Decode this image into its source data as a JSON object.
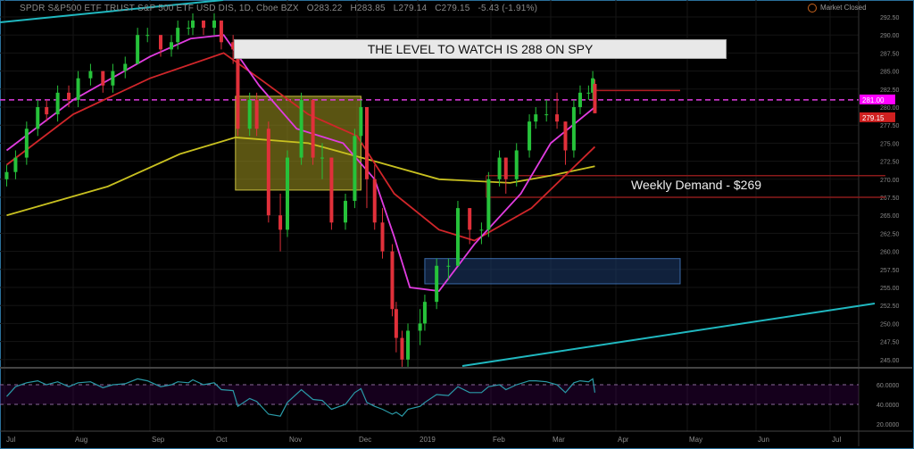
{
  "header": {
    "symbol": "SPDR S&P500 ETF TRUST S&P 500 ETF USD DIS, 1D, Cboe BZX",
    "open": "O283.22",
    "high": "H283.85",
    "low": "L279.14",
    "close": "C279.15",
    "change": "-5.43 (-1.91%)",
    "market_status": "Market Closed"
  },
  "annotations": {
    "title": "THE LEVEL TO WATCH IS 288 ON SPY",
    "weekly_demand": "Weekly Demand - $269"
  },
  "price_labels": {
    "level": "281.00",
    "last": "279.15"
  },
  "colors": {
    "up": "#26c23a",
    "down": "#e0303a",
    "ma_fast": "#e03ce0",
    "ma_mid": "#d0262a",
    "ma_slow": "#c8c020",
    "trend": "#20b8c0",
    "rsi": "#2a9aa8"
  },
  "chart_data": {
    "type": "candlestick",
    "title": "SPDR S&P500 ETF TRUST, 1D",
    "ylim": [
      244,
      294
    ],
    "yticks": [
      "292.50",
      "290.00",
      "287.50",
      "285.00",
      "282.50",
      "280.00",
      "277.50",
      "275.00",
      "272.50",
      "270.00",
      "267.50",
      "265.00",
      "262.50",
      "260.00",
      "257.50",
      "255.00",
      "252.50",
      "250.00",
      "247.50",
      "245.00"
    ],
    "xticks": [
      "Jul",
      "Aug",
      "Sep",
      "Oct",
      "Nov",
      "Dec",
      "2019",
      "Feb",
      "Mar",
      "Apr",
      "May",
      "Jun",
      "Jul"
    ],
    "candles": [
      [
        "2018-07-02",
        270,
        272,
        269,
        271
      ],
      [
        "2018-07-06",
        271,
        274,
        270,
        273
      ],
      [
        "2018-07-11",
        273,
        278,
        272,
        277
      ],
      [
        "2018-07-16",
        277,
        281,
        276,
        280
      ],
      [
        "2018-07-20",
        280,
        281,
        278,
        279
      ],
      [
        "2018-07-25",
        279,
        283,
        278,
        282
      ],
      [
        "2018-07-30",
        282,
        283,
        280,
        281
      ],
      [
        "2018-08-03",
        281,
        285,
        280,
        284
      ],
      [
        "2018-08-08",
        284,
        286,
        283,
        285
      ],
      [
        "2018-08-13",
        285,
        285,
        282,
        283
      ],
      [
        "2018-08-17",
        283,
        286,
        282,
        285
      ],
      [
        "2018-08-22",
        285,
        287,
        284,
        286
      ],
      [
        "2018-08-27",
        286,
        291,
        286,
        290
      ],
      [
        "2018-08-31",
        290,
        291,
        289,
        290
      ],
      [
        "2018-09-06",
        290,
        290,
        287,
        288
      ],
      [
        "2018-09-11",
        288,
        290,
        287,
        289
      ],
      [
        "2018-09-14",
        289,
        292,
        288,
        291
      ],
      [
        "2018-09-19",
        291,
        292,
        290,
        291
      ],
      [
        "2018-09-21",
        291,
        293,
        290,
        292
      ],
      [
        "2018-09-26",
        292,
        292,
        290,
        291
      ],
      [
        "2018-10-01",
        291,
        293,
        290,
        292
      ],
      [
        "2018-10-04",
        292,
        292,
        288,
        289
      ],
      [
        "2018-10-09",
        289,
        290,
        286,
        288
      ],
      [
        "2018-10-11",
        288,
        288,
        276,
        277
      ],
      [
        "2018-10-16",
        277,
        282,
        276,
        281
      ],
      [
        "2018-10-19",
        281,
        282,
        276,
        277
      ],
      [
        "2018-10-24",
        277,
        278,
        264,
        265
      ],
      [
        "2018-10-29",
        265,
        268,
        260,
        263
      ],
      [
        "2018-11-01",
        263,
        274,
        262,
        273
      ],
      [
        "2018-11-07",
        273,
        282,
        272,
        281
      ],
      [
        "2018-11-12",
        281,
        281,
        272,
        273
      ],
      [
        "2018-11-16",
        273,
        275,
        270,
        273
      ],
      [
        "2018-11-20",
        273,
        273,
        263,
        264
      ],
      [
        "2018-11-26",
        264,
        268,
        263,
        267
      ],
      [
        "2018-11-30",
        267,
        277,
        266,
        276
      ],
      [
        "2018-12-03",
        276,
        281,
        275,
        280
      ],
      [
        "2018-12-06",
        280,
        280,
        266,
        270
      ],
      [
        "2018-12-10",
        270,
        272,
        263,
        264
      ],
      [
        "2018-12-14",
        264,
        266,
        259,
        260
      ],
      [
        "2018-12-19",
        260,
        261,
        251,
        252
      ],
      [
        "2018-12-21",
        252,
        253,
        246,
        248
      ],
      [
        "2018-12-24",
        248,
        249,
        244,
        245
      ],
      [
        "2018-12-27",
        245,
        250,
        244,
        249
      ],
      [
        "2019-01-02",
        249,
        252,
        247,
        250
      ],
      [
        "2019-01-04",
        250,
        254,
        249,
        253
      ],
      [
        "2019-01-09",
        253,
        259,
        252,
        258
      ],
      [
        "2019-01-14",
        258,
        259,
        256,
        258
      ],
      [
        "2019-01-18",
        258,
        267,
        258,
        266
      ],
      [
        "2019-01-23",
        266,
        266,
        261,
        263
      ],
      [
        "2019-01-28",
        263,
        264,
        261,
        263
      ],
      [
        "2019-01-31",
        263,
        271,
        262,
        270
      ],
      [
        "2019-02-05",
        270,
        274,
        269,
        273
      ],
      [
        "2019-02-08",
        273,
        273,
        268,
        270
      ],
      [
        "2019-02-13",
        270,
        275,
        269,
        274
      ],
      [
        "2019-02-19",
        274,
        279,
        273,
        278
      ],
      [
        "2019-02-22",
        278,
        280,
        277,
        279
      ],
      [
        "2019-02-27",
        279,
        281,
        278,
        279
      ],
      [
        "2019-03-04",
        279,
        282,
        277,
        278
      ],
      [
        "2019-03-08",
        278,
        278,
        272,
        274
      ],
      [
        "2019-03-12",
        274,
        281,
        273,
        280
      ],
      [
        "2019-03-15",
        280,
        283,
        279,
        282
      ],
      [
        "2019-03-19",
        282,
        283,
        281,
        282
      ],
      [
        "2019-03-21",
        282,
        285,
        281,
        284
      ],
      [
        "2019-03-22",
        283.22,
        283.85,
        279.14,
        279.15
      ]
    ],
    "ma_fast": [
      [
        "2018-07-02",
        274
      ],
      [
        "2018-08-01",
        281
      ],
      [
        "2018-09-01",
        287
      ],
      [
        "2018-09-20",
        289.5
      ],
      [
        "2018-10-05",
        290
      ],
      [
        "2018-10-20",
        283
      ],
      [
        "2018-11-05",
        277
      ],
      [
        "2018-11-25",
        275
      ],
      [
        "2018-12-10",
        270
      ],
      [
        "2018-12-20",
        262
      ],
      [
        "2018-12-28",
        255
      ],
      [
        "2019-01-10",
        254.5
      ],
      [
        "2019-01-25",
        261
      ],
      [
        "2019-02-15",
        268
      ],
      [
        "2019-03-01",
        275
      ],
      [
        "2019-03-22",
        280
      ]
    ],
    "ma_mid": [
      [
        "2018-07-02",
        272
      ],
      [
        "2018-08-01",
        279
      ],
      [
        "2018-09-01",
        284
      ],
      [
        "2018-10-05",
        287.5
      ],
      [
        "2018-10-20",
        284
      ],
      [
        "2018-11-10",
        279
      ],
      [
        "2018-12-01",
        276
      ],
      [
        "2018-12-20",
        268
      ],
      [
        "2019-01-10",
        263
      ],
      [
        "2019-01-25",
        261.5
      ],
      [
        "2019-02-20",
        266
      ],
      [
        "2019-03-22",
        274.5
      ]
    ],
    "ma_slow": [
      [
        "2018-07-02",
        265
      ],
      [
        "2018-08-15",
        269
      ],
      [
        "2018-09-15",
        273.5
      ],
      [
        "2018-10-10",
        275.8
      ],
      [
        "2018-11-10",
        275
      ],
      [
        "2018-12-10",
        272.5
      ],
      [
        "2019-01-10",
        270
      ],
      [
        "2019-02-10",
        269.5
      ],
      [
        "2019-03-01",
        270.5
      ],
      [
        "2019-03-22",
        271.8
      ]
    ],
    "zones": [
      {
        "name": "supply-zone",
        "from": "2018-10-10",
        "to": "2018-12-03",
        "top": 281.5,
        "bottom": 268.5
      },
      {
        "name": "demand-zone",
        "from": "2019-01-04",
        "to": "2019-04-28",
        "top": 259,
        "bottom": 255.5
      },
      {
        "name": "weekly-demand",
        "from": "2019-01-30",
        "to": "2019-07-25",
        "top": 270.5,
        "bottom": 267.5
      }
    ],
    "levels": [
      {
        "name": "resistance",
        "value": 282.3
      },
      {
        "name": "dashed-level",
        "value": 281
      }
    ],
    "rsi": {
      "levels": [
        60,
        40
      ],
      "yticks": [
        "60.0000",
        "40.0000",
        "20.0000"
      ],
      "values": [
        48,
        58,
        62,
        64,
        60,
        63,
        58,
        62,
        63,
        57,
        60,
        61,
        66,
        64,
        58,
        60,
        63,
        62,
        65,
        60,
        62,
        55,
        54,
        38,
        46,
        43,
        30,
        28,
        42,
        55,
        45,
        44,
        35,
        40,
        52,
        56,
        42,
        38,
        35,
        30,
        32,
        28,
        35,
        38,
        42,
        50,
        49,
        58,
        52,
        52,
        58,
        60,
        55,
        60,
        64,
        64,
        63,
        60,
        52,
        62,
        64,
        63,
        66,
        52
      ]
    }
  }
}
